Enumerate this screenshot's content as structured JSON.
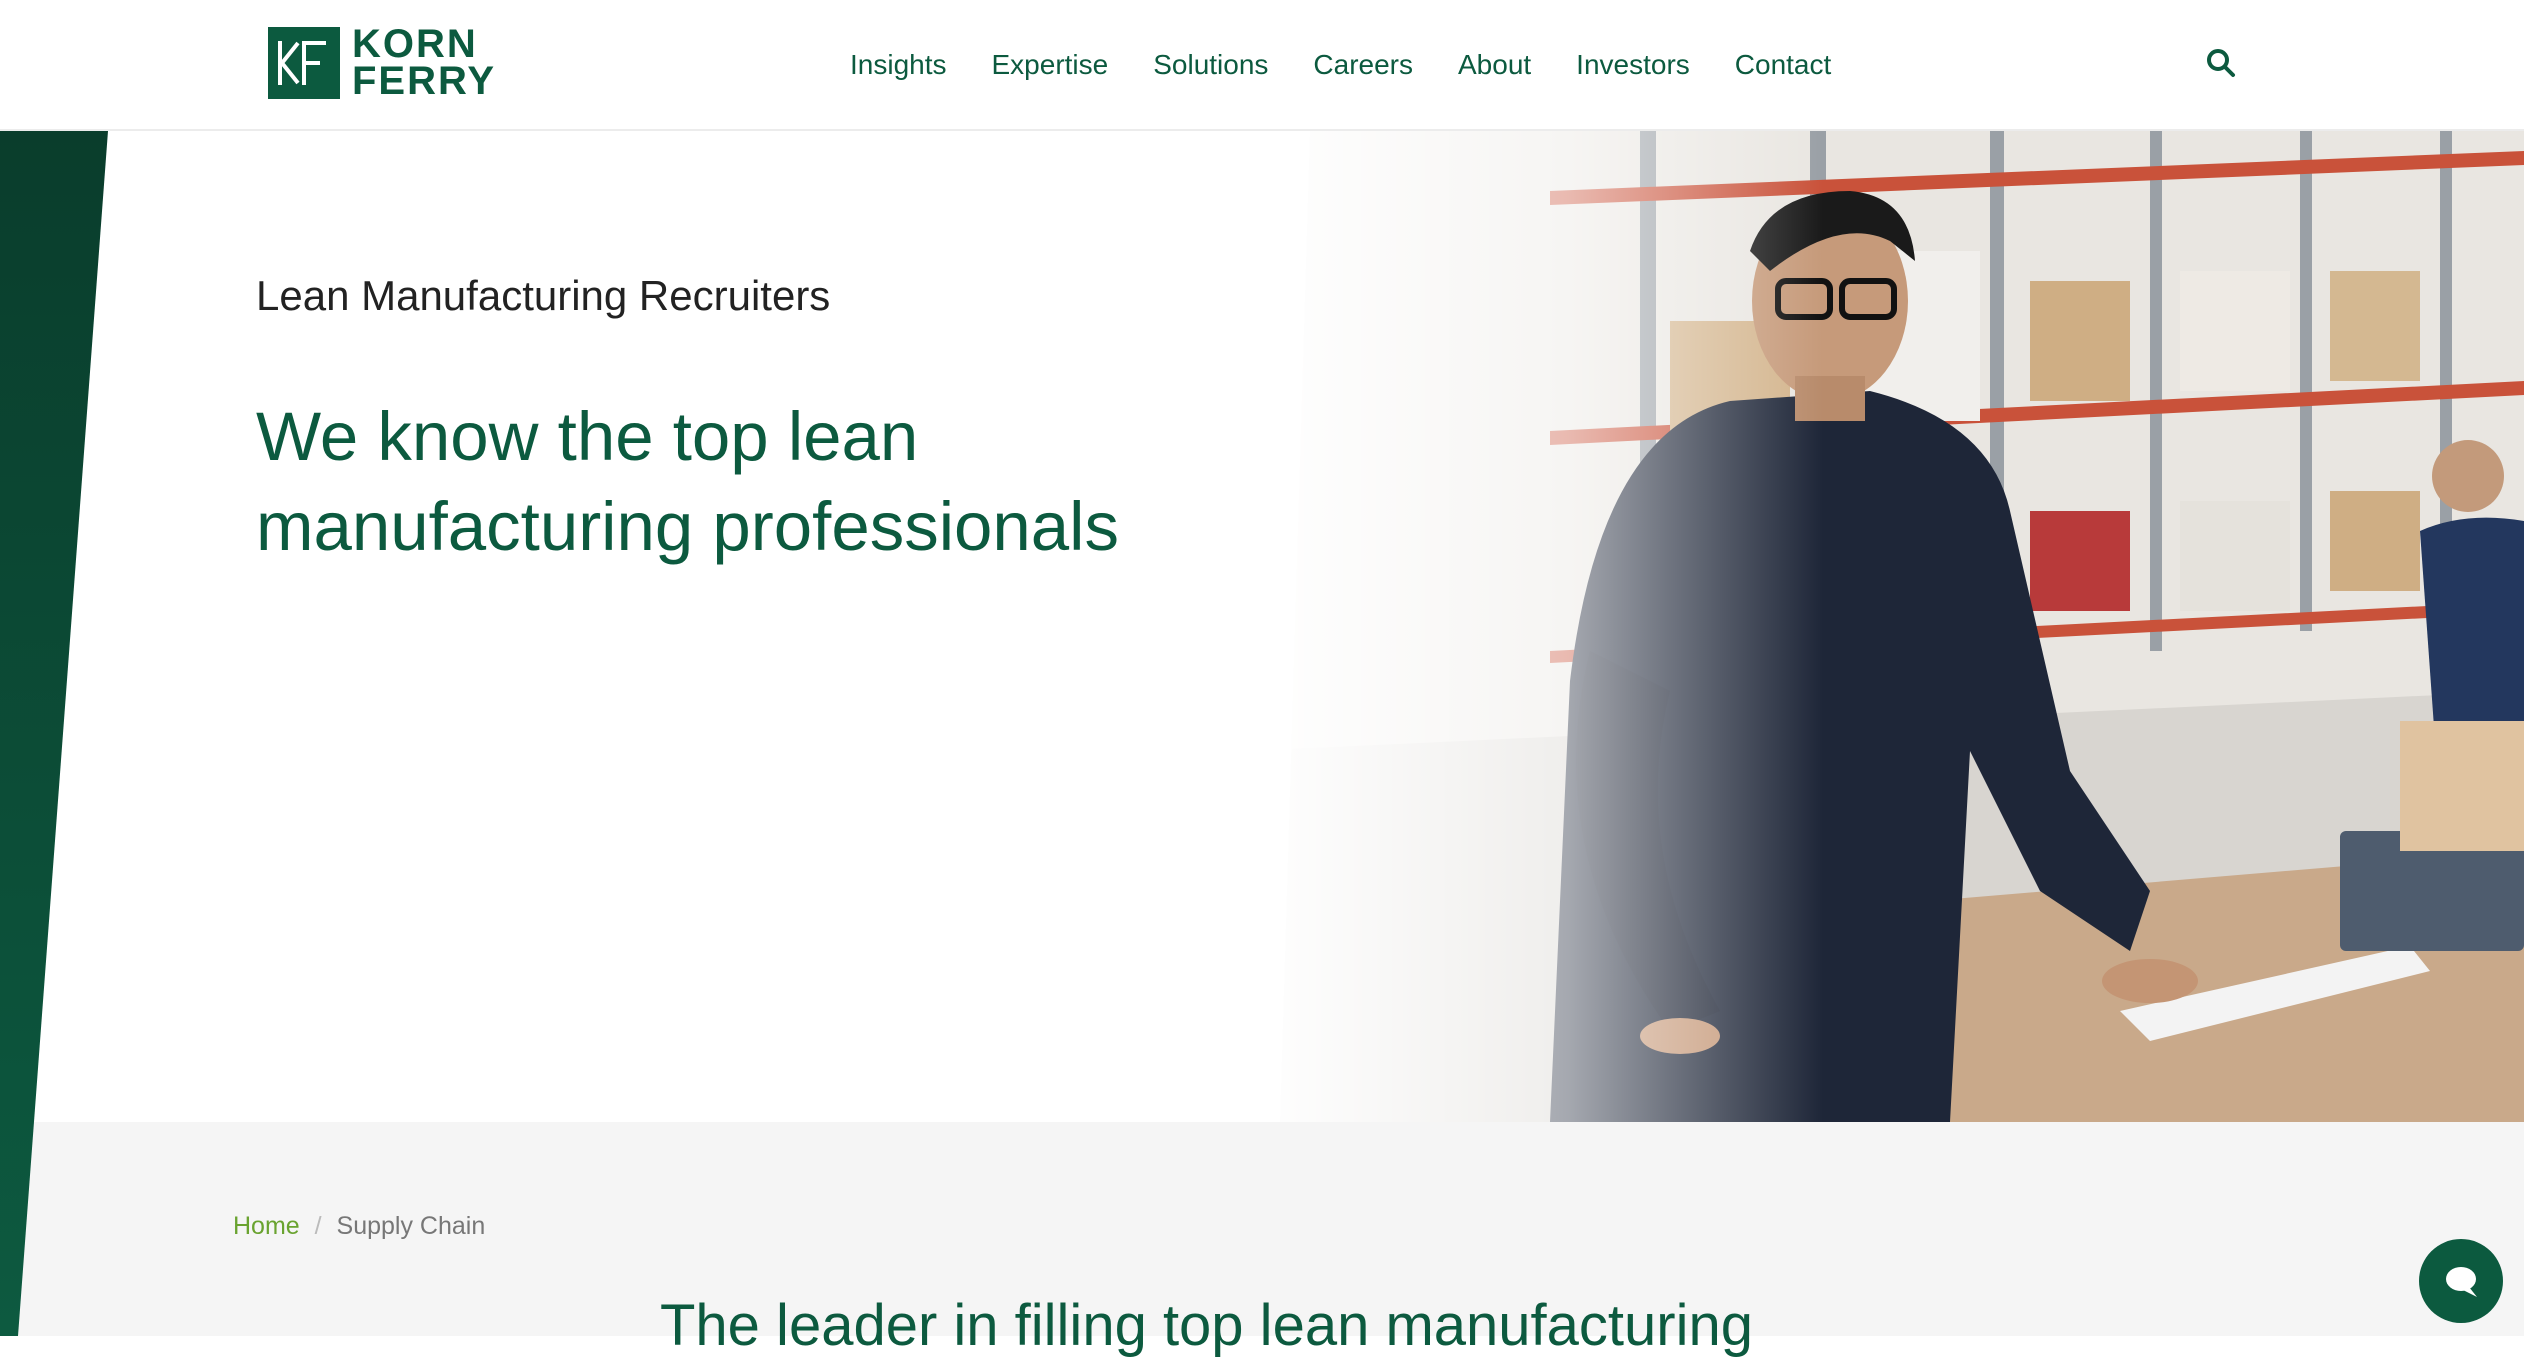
{
  "header": {
    "logo": {
      "line1": "KORN",
      "line2": "FERRY",
      "mark_text": "KF"
    },
    "nav": [
      "Insights",
      "Expertise",
      "Solutions",
      "Careers",
      "About",
      "Investors",
      "Contact"
    ],
    "search_icon": "search-icon"
  },
  "hero": {
    "eyebrow": "Lean Manufacturing Recruiters",
    "title": "We know the top lean manufacturing professionals",
    "photo": "warehouse-worker-photo"
  },
  "breadcrumb": {
    "home": "Home",
    "separator": "/",
    "current": "Supply Chain"
  },
  "section": {
    "heading": "The leader in filling top lean manufacturing"
  },
  "chat": {
    "icon": "chat-bubble-icon"
  },
  "colors": {
    "brand_green": "#0c5a3f",
    "link_green": "#6aa330",
    "band_gray": "#f5f5f5"
  }
}
